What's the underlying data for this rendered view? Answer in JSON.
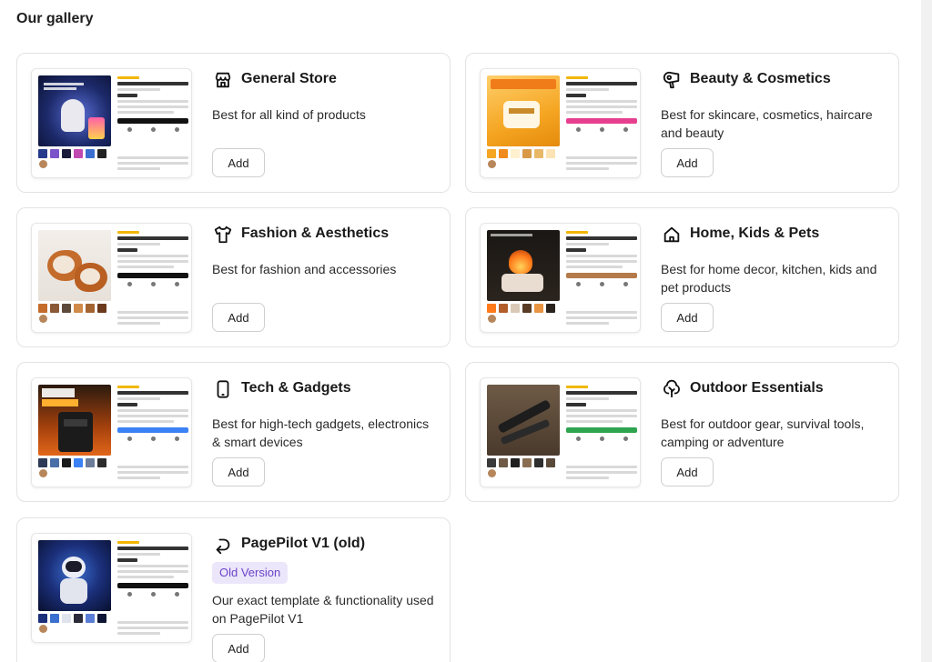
{
  "page": {
    "title": "Our gallery"
  },
  "cards": [
    {
      "title": "General Store",
      "description": "Best for all kind of products",
      "add_label": "Add",
      "icon": "store-icon",
      "accent": "#111111"
    },
    {
      "title": "Beauty & Cosmetics",
      "description": "Best for skincare, cosmetics, haircare and beauty",
      "add_label": "Add",
      "icon": "hair-dryer-icon",
      "accent": "#e6408f"
    },
    {
      "title": "Fashion & Aesthetics",
      "description": "Best for fashion and accessories",
      "add_label": "Add",
      "icon": "shirt-icon",
      "accent": "#111111"
    },
    {
      "title": "Home, Kids & Pets",
      "description": "Best for home decor, kitchen, kids and pet products",
      "add_label": "Add",
      "icon": "home-icon",
      "accent": "#b57a4a"
    },
    {
      "title": "Tech & Gadgets",
      "description": "Best for high-tech gadgets, electronics & smart devices",
      "add_label": "Add",
      "icon": "phone-icon",
      "accent": "#3b82f6"
    },
    {
      "title": "Outdoor Essentials",
      "description": "Best for outdoor gear, survival tools, camping or adventure",
      "add_label": "Add",
      "icon": "tree-icon",
      "accent": "#2ea44f"
    },
    {
      "title": "PagePilot V1 (old)",
      "badge": "Old Version",
      "description": "Our exact template & functionality used on PagePilot V1",
      "add_label": "Add",
      "icon": "undo-arrow-icon",
      "accent": "#111111"
    }
  ],
  "previews": [
    {
      "name": "Astronaut Starry Night Light",
      "hero_text": "ASTRONAUT FILM PROJECTOR LAMP"
    },
    {
      "name": "GlowBoost Turmeric Mask",
      "hero_text": "Turmeric clay mask"
    },
    {
      "name": "Cozy Comfort Slippers",
      "hero_text": ""
    },
    {
      "name": "FlameGlow Aroma Diffuser",
      "hero_text": "Flame aroma diffuser"
    },
    {
      "name": "Super Charge Power Hub",
      "hero_text": "120W 20000mAh"
    },
    {
      "name": "Pocket Hero Knife",
      "hero_text": ""
    },
    {
      "name": "Astronaut Starry Projector Light",
      "hero_text": ""
    }
  ]
}
